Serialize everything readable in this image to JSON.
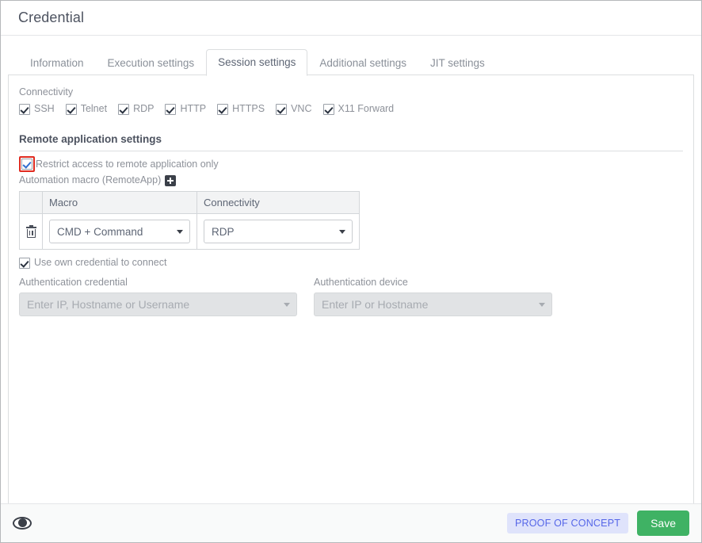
{
  "window": {
    "title": "Credential"
  },
  "tabs": [
    {
      "label": "Information",
      "active": false
    },
    {
      "label": "Execution settings",
      "active": false
    },
    {
      "label": "Session settings",
      "active": true
    },
    {
      "label": "Additional settings",
      "active": false
    },
    {
      "label": "JIT settings",
      "active": false
    }
  ],
  "connectivity": {
    "label": "Connectivity",
    "options": [
      {
        "label": "SSH",
        "checked": true
      },
      {
        "label": "Telnet",
        "checked": true
      },
      {
        "label": "RDP",
        "checked": true
      },
      {
        "label": "HTTP",
        "checked": true
      },
      {
        "label": "HTTPS",
        "checked": true
      },
      {
        "label": "VNC",
        "checked": true
      },
      {
        "label": "X11 Forward",
        "checked": true
      }
    ]
  },
  "remote_application": {
    "heading": "Remote application settings",
    "restrict": {
      "label": "Restrict access to remote application only",
      "checked": true,
      "highlight_color": "#e02b20"
    },
    "macro_label": "Automation macro (RemoteApp)",
    "add_icon": "plus-icon",
    "table": {
      "columns": [
        "",
        "Macro",
        "Connectivity"
      ],
      "rows": [
        {
          "delete_icon": "trash-icon",
          "macro": "CMD + Command",
          "connectivity": "RDP"
        }
      ]
    }
  },
  "authentication": {
    "use_own_credential": {
      "label": "Use own credential to connect",
      "checked": true
    },
    "credential": {
      "label": "Authentication credential",
      "placeholder": "Enter IP, Hostname or Username",
      "value": "",
      "disabled": true
    },
    "device": {
      "label": "Authentication device",
      "placeholder": "Enter IP or Hostname",
      "value": "",
      "disabled": true
    }
  },
  "footer": {
    "preview_icon": "eye-icon",
    "badge": "PROOF OF CONCEPT",
    "badge_color": "#5566e8",
    "badge_bg": "#dfe3fb",
    "save_label": "Save",
    "save_color": "#3fb264"
  }
}
